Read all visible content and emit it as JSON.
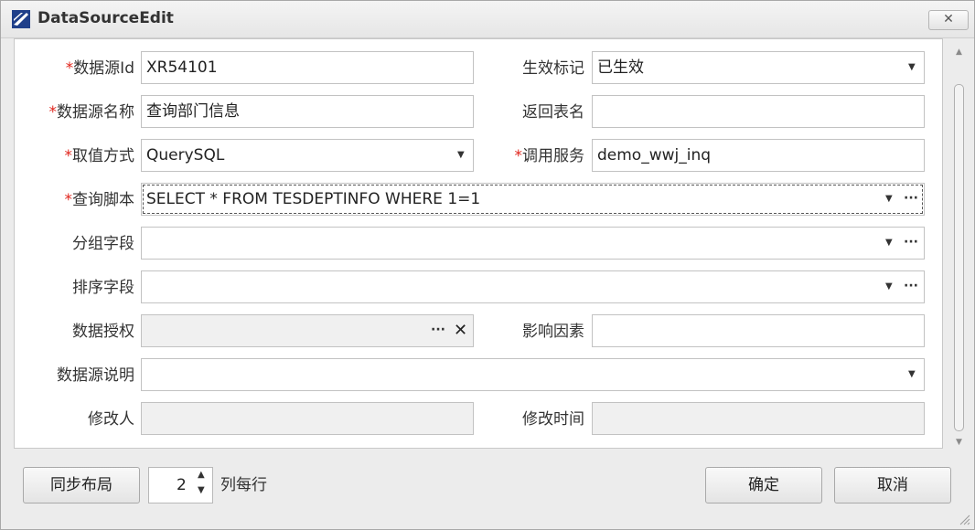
{
  "window": {
    "title": "DataSourceEdit",
    "close_label": "✕"
  },
  "form": {
    "datasource_id": {
      "required": "*",
      "label": "数据源Id",
      "value": "XR54101"
    },
    "effective_flag": {
      "label": "生效标记",
      "value": "已生效"
    },
    "datasource_name": {
      "required": "*",
      "label": "数据源名称",
      "value": "查询部门信息"
    },
    "return_table": {
      "label": "返回表名",
      "value": ""
    },
    "value_method": {
      "required": "*",
      "label": "取值方式",
      "value": "QuerySQL"
    },
    "call_service": {
      "required": "*",
      "label": "调用服务",
      "value": "demo_wwj_inq"
    },
    "query_script": {
      "required": "*",
      "label": "查询脚本",
      "value": "SELECT * FROM TESDEPTINFO WHERE 1=1"
    },
    "group_fields": {
      "label": "分组字段",
      "value": ""
    },
    "sort_fields": {
      "label": "排序字段",
      "value": ""
    },
    "data_auth": {
      "label": "数据授权",
      "value": ""
    },
    "impact_factor": {
      "label": "影响因素",
      "value": ""
    },
    "description": {
      "label": "数据源说明",
      "value": ""
    },
    "modifier": {
      "label": "修改人",
      "value": ""
    },
    "modify_time": {
      "label": "修改时间",
      "value": ""
    }
  },
  "glyphs": {
    "arrow": "▼",
    "more": "···",
    "clear": "✕",
    "spin_up": "▲",
    "spin_down": "▼",
    "scroll_up": "▲",
    "scroll_down": "▼"
  },
  "footer": {
    "sync_layout": "同步布局",
    "columns_value": "2",
    "columns_label": "列每行",
    "ok": "确定",
    "cancel": "取消"
  },
  "colors": {
    "required": "#e0241b",
    "icon_blue": "#2a5fb0"
  }
}
